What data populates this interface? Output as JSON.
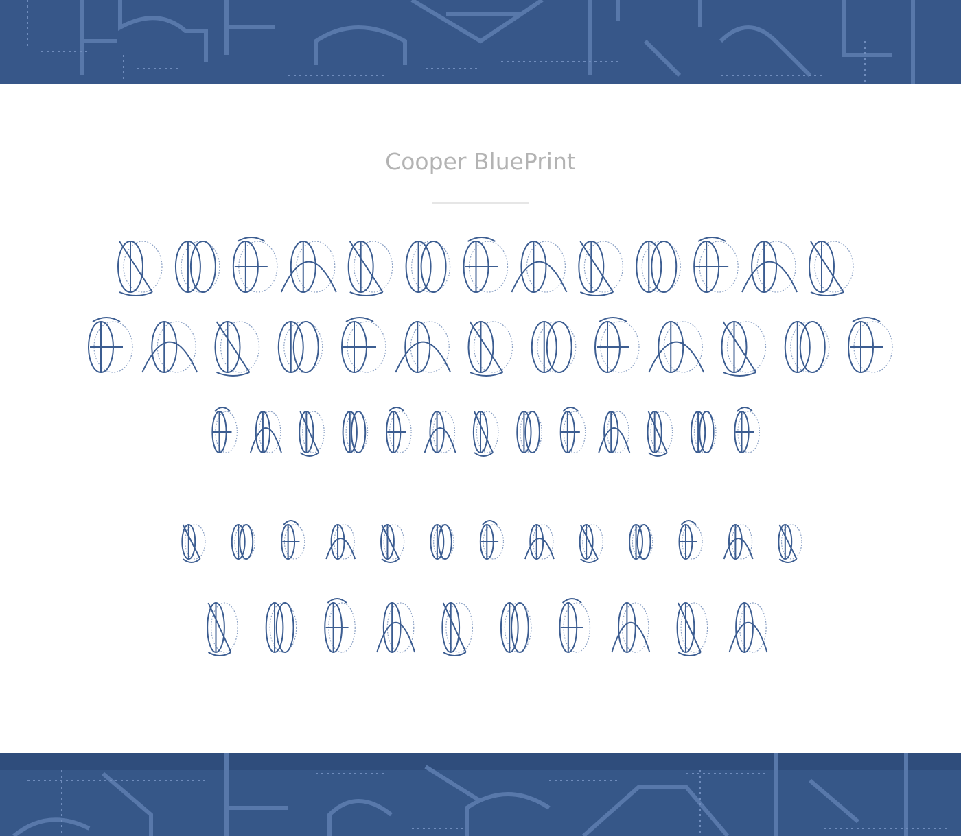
{
  "title": "Cooper BluePrint",
  "colors": {
    "band": "#375789",
    "pattern": "#5674a6",
    "glyph_stroke": "#3c5d91",
    "glyph_guide": "#8aa0c4",
    "title": "#b3b3b3"
  },
  "glyph_rows": [
    [
      "A",
      "B",
      "C",
      "D",
      "E",
      "F",
      "G",
      "H",
      "I",
      "J",
      "K",
      "L",
      "M"
    ],
    [
      "N",
      "O",
      "P",
      "Q",
      "R",
      "S",
      "T",
      "U",
      "V",
      "W",
      "X",
      "Y",
      "Z"
    ],
    [
      "a",
      "b",
      "c",
      "d",
      "e",
      "f",
      "g",
      "h",
      "i",
      "j",
      "k",
      "l",
      "m"
    ],
    [
      "n",
      "o",
      "p",
      "q",
      "r",
      "s",
      "t",
      "u",
      "v",
      "w",
      "x",
      "y",
      "z"
    ],
    [
      "1",
      "2",
      "3",
      "4",
      "5",
      "6",
      "7",
      "8",
      "9",
      "0"
    ]
  ]
}
